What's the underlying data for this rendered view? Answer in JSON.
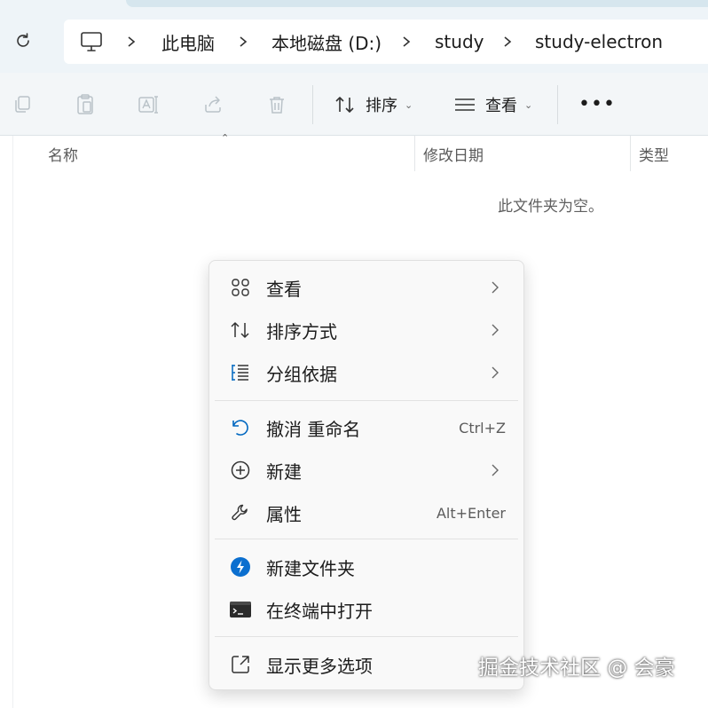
{
  "addressbar": {
    "crumbs": [
      "此电脑",
      "本地磁盘 (D:)",
      "study",
      "study-electron"
    ]
  },
  "toolbar": {
    "sort_label": "排序",
    "view_label": "查看",
    "more_label": "•••"
  },
  "columns": {
    "name": "名称",
    "modified": "修改日期",
    "type": "类型"
  },
  "empty_message": "此文件夹为空。",
  "context_menu": {
    "items": [
      {
        "label": "查看",
        "icon": "grid-icon",
        "submenu": true
      },
      {
        "label": "排序方式",
        "icon": "sort-icon",
        "submenu": true
      },
      {
        "label": "分组依据",
        "icon": "group-list-icon",
        "submenu": true
      },
      {
        "label": "撤消 重命名",
        "icon": "undo-icon",
        "shortcut": "Ctrl+Z"
      },
      {
        "label": "新建",
        "icon": "new-plus-icon",
        "submenu": true
      },
      {
        "label": "属性",
        "icon": "wrench-icon",
        "shortcut": "Alt+Enter"
      },
      {
        "label": "新建文件夹",
        "icon": "quick-action-icon"
      },
      {
        "label": "在终端中打开",
        "icon": "terminal-icon"
      },
      {
        "label": "显示更多选项",
        "icon": "open-external-icon"
      }
    ]
  },
  "watermark": "掘金技术社区 @ 会豪",
  "colors": {
    "top_strip": "#eef4f8",
    "toolbar_bg": "#f3f6f8",
    "menu_bg": "#f9f9f9",
    "accent": "#0067c0"
  }
}
